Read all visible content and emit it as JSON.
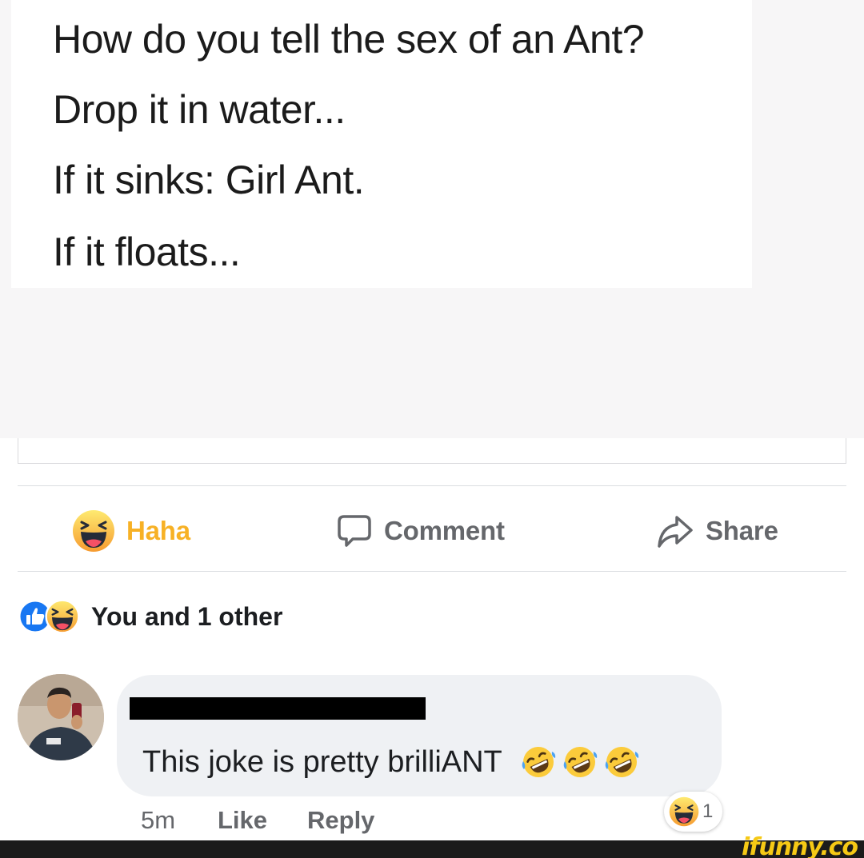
{
  "post": {
    "lines": [
      "How do you tell the sex of an Ant?",
      "Drop it in water...",
      "If it sinks: Girl Ant.",
      "If it floats..."
    ]
  },
  "actions": {
    "haha_label": "Haha",
    "comment_label": "Comment",
    "share_label": "Share"
  },
  "reactions": {
    "summary": "You and 1 other",
    "icons": [
      "like-icon",
      "haha-icon"
    ]
  },
  "comment": {
    "text": "This joke is pretty brilliANT",
    "emojis": [
      "rofl-icon",
      "rofl-icon",
      "rofl-icon"
    ],
    "time": "5m",
    "like_label": "Like",
    "reply_label": "Reply",
    "reaction_count": "1"
  },
  "watermark": "ifunny.co",
  "colors": {
    "haha_active": "#f7b125",
    "like_blue": "#1877f2",
    "muted_text": "#65676b",
    "bubble_bg": "#eff1f4",
    "watermark_yellow": "#f6c915"
  }
}
